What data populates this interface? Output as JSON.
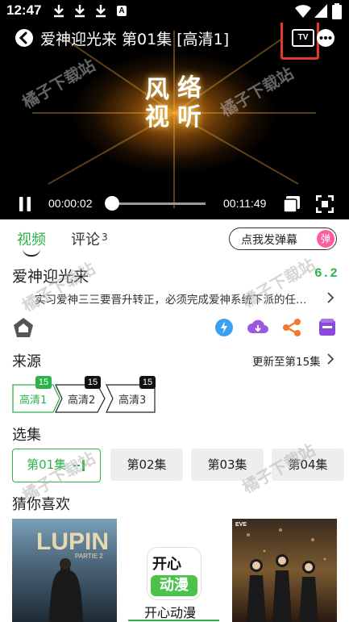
{
  "status_bar": {
    "time": "12:47",
    "badge": "A"
  },
  "player": {
    "title": "爱神迎光来 第01集 [高清1]",
    "tv_label": "TV",
    "logo_chars": [
      "风",
      "络",
      "视",
      "听"
    ],
    "current_time": "00:00:02",
    "total_time": "00:11:49",
    "progress": 0.003
  },
  "watermark": "橘子下载站",
  "tabs": {
    "video": "视频",
    "comment": "评论",
    "comment_count": "3"
  },
  "danmu": {
    "label": "点我发弹幕",
    "icon_text": "弹"
  },
  "show": {
    "title": "爱神迎光来",
    "rating": "6.2",
    "description": "实习爱神三三要晋升转正，必须完成爱神系统下派的任…"
  },
  "sources": {
    "heading": "来源",
    "update_text": "更新至第15集",
    "items": [
      {
        "label": "高清1",
        "count": "15",
        "active": true
      },
      {
        "label": "高清2",
        "count": "15",
        "active": false
      },
      {
        "label": "高清3",
        "count": "15",
        "active": false
      }
    ]
  },
  "episodes": {
    "heading": "选集",
    "items": [
      {
        "label": "第01集",
        "active": true
      },
      {
        "label": "第02集",
        "active": false
      },
      {
        "label": "第03集",
        "active": false
      },
      {
        "label": "第04集",
        "active": false
      }
    ]
  },
  "recommend": {
    "heading": "猜你喜欢",
    "items": [
      {
        "poster_title": "LUPIN",
        "poster_sub": "PARTIE 2"
      },
      {
        "poster_title": "开心动漫",
        "logo_top": "开心",
        "logo_bottom": "动漫"
      },
      {
        "poster_title": "",
        "badge": "EVE"
      }
    ]
  },
  "colors": {
    "accent": "#2db34a",
    "highlight": "#e23a2a",
    "danmu": "#ff5da2"
  }
}
